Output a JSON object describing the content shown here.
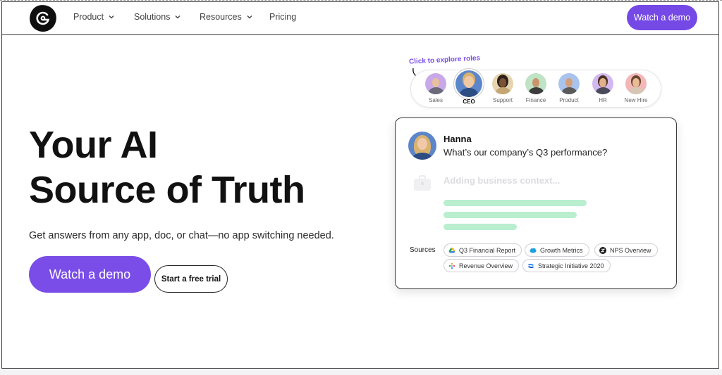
{
  "nav": {
    "logo_alt": "Glean logo",
    "items": [
      {
        "label": "Product",
        "has_dropdown": true
      },
      {
        "label": "Solutions",
        "has_dropdown": true
      },
      {
        "label": "Resources",
        "has_dropdown": true
      },
      {
        "label": "Pricing",
        "has_dropdown": false
      }
    ],
    "cta_label": "Watch a demo"
  },
  "hero": {
    "title_line1": "Your AI",
    "title_line2": "Source of Truth",
    "subtitle": "Get answers from any app, doc, or chat—no app switching needed.",
    "primary_button": "Watch a demo",
    "secondary_button": "Start a free trial"
  },
  "roles": {
    "hint": "Click to explore roles",
    "items": [
      {
        "label": "Sales",
        "active": false,
        "color": "#c9a8e8"
      },
      {
        "label": "CEO",
        "active": true,
        "color": "#5c86c9"
      },
      {
        "label": "Support",
        "active": false,
        "color": "#e6d4b0"
      },
      {
        "label": "Finance",
        "active": false,
        "color": "#bfe3c4"
      },
      {
        "label": "Product",
        "active": false,
        "color": "#a9c4ec"
      },
      {
        "label": "HR",
        "active": false,
        "color": "#d2b8ee"
      },
      {
        "label": "New Hire",
        "active": false,
        "color": "#f2b8b8"
      }
    ]
  },
  "chat": {
    "user_name": "Hanna",
    "question": "What’s our company’s Q3 performance?",
    "status": "Adding business context...",
    "sources_label": "Sources",
    "sources": [
      {
        "label": "Q3 Financial Report",
        "icon": "google-drive-icon"
      },
      {
        "label": "Growth Metrics",
        "icon": "salesforce-icon"
      },
      {
        "label": "NPS Overview",
        "icon": "zendesk-icon"
      },
      {
        "label": "Revenue Overview",
        "icon": "looker-icon"
      },
      {
        "label": "Strategic Initiative 2020",
        "icon": "confluence-icon"
      }
    ]
  },
  "colors": {
    "accent": "#7a4de8",
    "bar_green": "#b9eecf"
  }
}
